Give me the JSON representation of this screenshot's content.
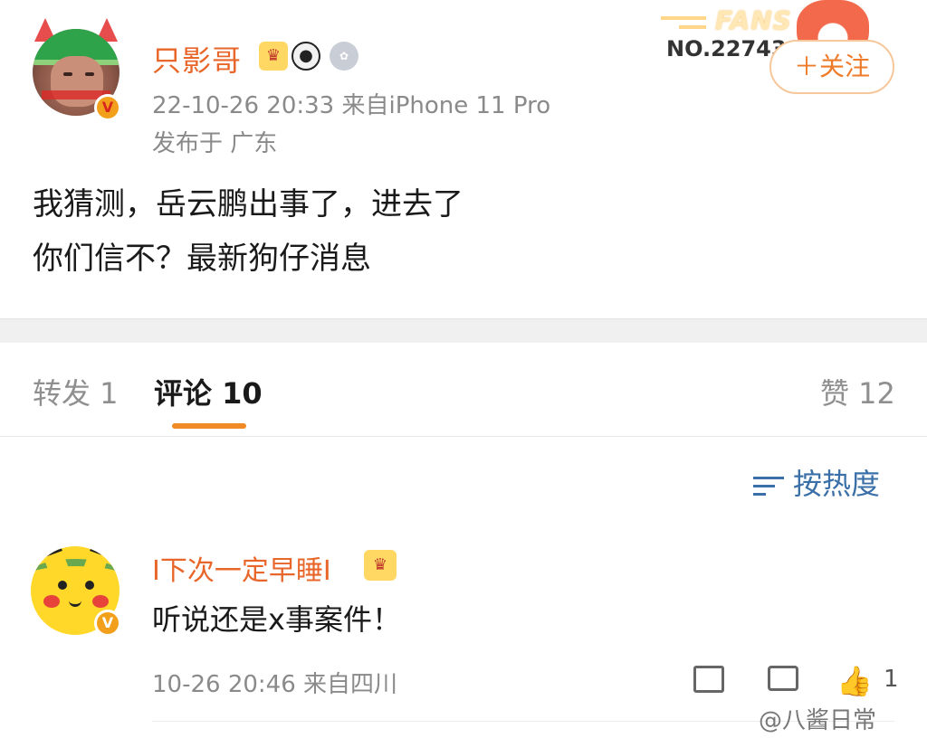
{
  "post": {
    "username": "只影哥",
    "badges": [
      "crown-badge-icon",
      "panda-badge-icon",
      "medal-badge-icon"
    ],
    "timestamp_source": "22-10-26 20:33  来自iPhone 11 Pro",
    "location": "发布于 广东",
    "text_line1": "我猜测，岳云鹏出事了，进去了",
    "text_line2": "你们信不？最新狗仔消息",
    "fans_label": "FANS",
    "fans_number": "NO.227436",
    "follow_label": "＋关注"
  },
  "tabs": {
    "repost": "转发 1",
    "comment": "评论 10",
    "like": "赞 12"
  },
  "sort_label": "按热度",
  "comment": {
    "username": "I下次一定早睡I",
    "text": "听说还是x事案件！",
    "meta": "10-26 20:46  来自四川",
    "like_count": "1"
  },
  "watermark": "@八酱日常",
  "colors": {
    "accent": "#e8662a",
    "tab_underline": "#f08a24",
    "link_blue": "#3a6fa8"
  }
}
